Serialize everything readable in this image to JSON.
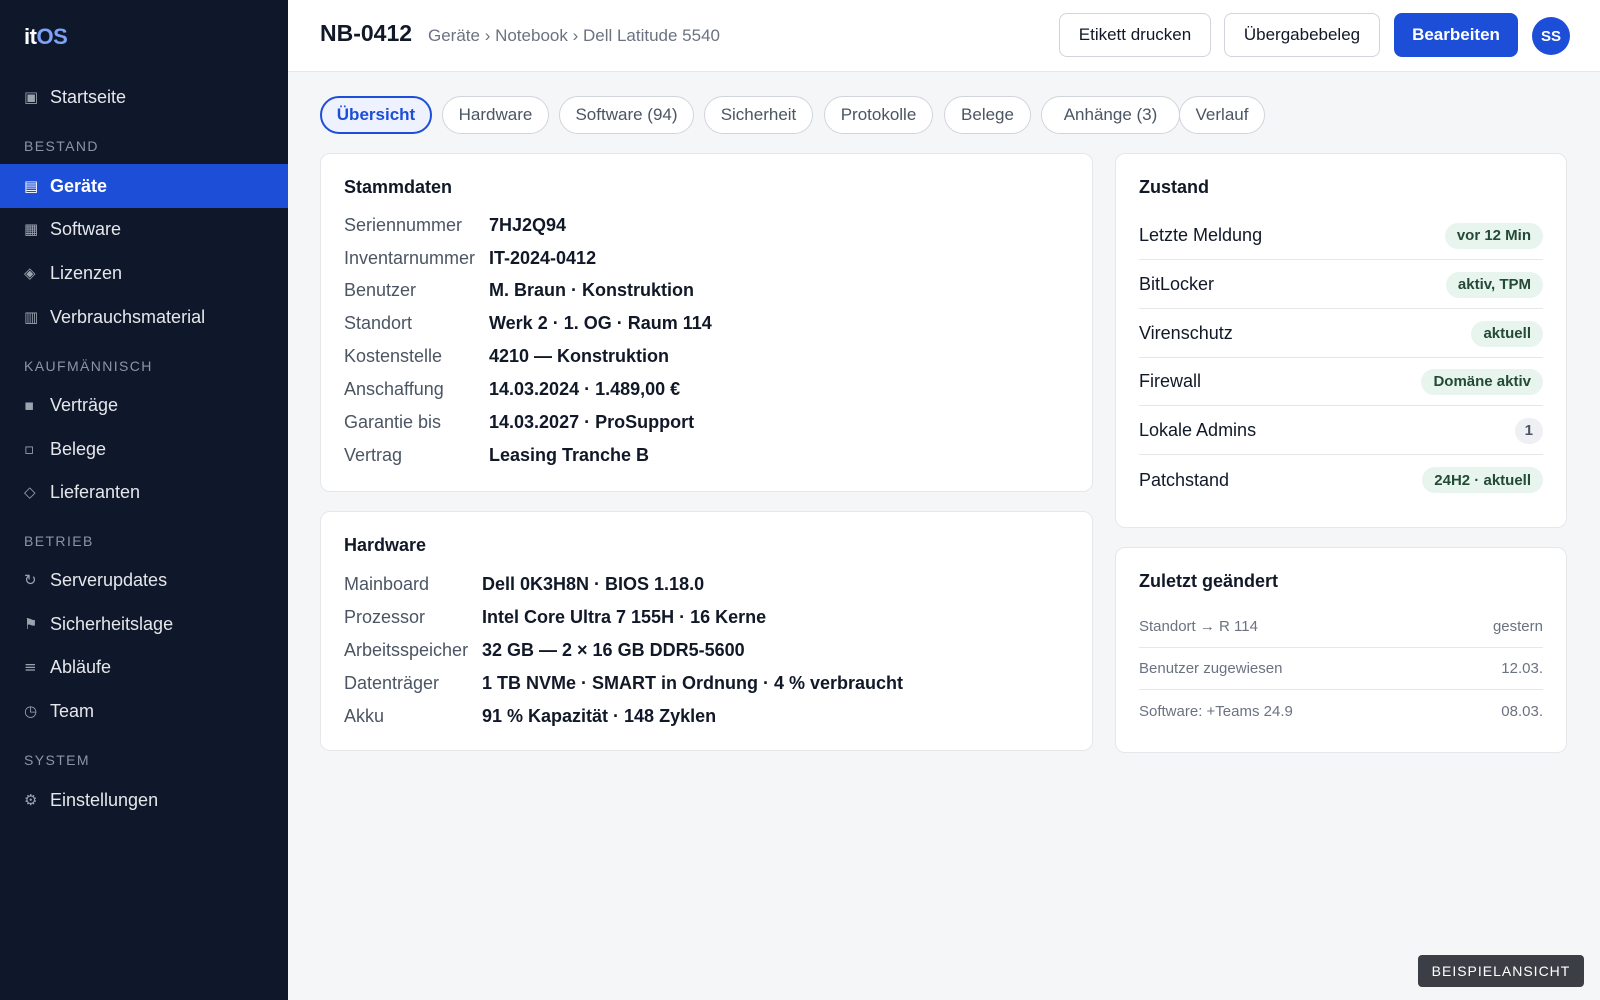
{
  "app": {
    "logo_it": "it",
    "logo_os": "OS"
  },
  "sidebar": {
    "home": {
      "label": "Startseite",
      "icon": "▣"
    },
    "sections": [
      "BESTAND",
      "KAUFMÄNNISCH",
      "BETRIEB",
      "SYSTEM"
    ],
    "items": [
      {
        "label": "Geräte",
        "icon": "▤",
        "active": true
      },
      {
        "label": "Software",
        "icon": "▦"
      },
      {
        "label": "Lizenzen",
        "icon": "◈"
      },
      {
        "label": "Verbrauchsmaterial",
        "icon": "▥"
      },
      {
        "label": "Verträge",
        "icon": "▪"
      },
      {
        "label": "Belege",
        "icon": "▫"
      },
      {
        "label": "Lieferanten",
        "icon": "◇"
      },
      {
        "label": "Serverupdates",
        "icon": "↻"
      },
      {
        "label": "Sicherheitslage",
        "icon": "⚑"
      },
      {
        "label": "Abläufe",
        "icon": "≡"
      },
      {
        "label": "Team",
        "icon": "◷"
      },
      {
        "label": "Einstellungen",
        "icon": "⚙"
      }
    ]
  },
  "header": {
    "title": "NB-0412",
    "breadcrumb": "Geräte › Notebook › Dell Latitude 5540",
    "buttons": {
      "print_label": "Etikett drucken",
      "handover": "Übergabebeleg",
      "edit": "Bearbeiten"
    },
    "avatar": "SS"
  },
  "tabs": [
    "Übersicht",
    "Hardware",
    "Software (94)",
    "Sicherheit",
    "Protokolle",
    "Belege",
    "Anhänge (3)",
    "Verlauf"
  ],
  "stammdaten": {
    "title": "Stammdaten",
    "rows": [
      {
        "label": "Seriennummer",
        "value": "7HJ2Q94"
      },
      {
        "label": "Inventarnummer",
        "value": "IT-2024-0412"
      },
      {
        "label": "Benutzer",
        "value": "M. Braun · Konstruktion"
      },
      {
        "label": "Standort",
        "value": "Werk 2 · 1. OG · Raum 114"
      },
      {
        "label": "Kostenstelle",
        "value": "4210 — Konstruktion"
      },
      {
        "label": "Anschaffung",
        "value": "14.03.2024 · 1.489,00 €"
      },
      {
        "label": "Garantie bis",
        "value": "14.03.2027 · ProSupport"
      },
      {
        "label": "Vertrag",
        "value": "Leasing Tranche B"
      }
    ]
  },
  "hardware": {
    "title": "Hardware",
    "rows": [
      {
        "label": "Mainboard",
        "value": "Dell 0K3H8N · BIOS 1.18.0"
      },
      {
        "label": "Prozessor",
        "value": "Intel Core Ultra 7 155H · 16 Kerne"
      },
      {
        "label": "Arbeitsspeicher",
        "value": "32 GB — 2 × 16 GB DDR5-5600"
      },
      {
        "label": "Datenträger",
        "value": "1 TB NVMe · SMART in Ordnung · 4 % verbraucht"
      },
      {
        "label": "Akku",
        "value": "91 % Kapazität · 148 Zyklen"
      }
    ]
  },
  "zustand": {
    "title": "Zustand",
    "rows": [
      {
        "label": "Letzte Meldung",
        "badge": "vor 12 Min"
      },
      {
        "label": "BitLocker",
        "badge": "aktiv, TPM"
      },
      {
        "label": "Virenschutz",
        "badge": "aktuell"
      },
      {
        "label": "Firewall",
        "badge": "Domäne aktiv"
      },
      {
        "label": "Lokale Admins",
        "badge": "1"
      },
      {
        "label": "Patchstand",
        "badge": "24H2 · aktuell"
      }
    ]
  },
  "changes": {
    "title": "Zuletzt geändert",
    "rows": [
      {
        "label": "Standort → R 114",
        "date": "gestern"
      },
      {
        "label": "Benutzer zugewiesen",
        "date": "12.03."
      },
      {
        "label": "Software: +Teams 24.9",
        "date": "08.03."
      }
    ]
  },
  "footer_tag": "BEISPIELANSICHT",
  "colors": {
    "accent": "#1d4ed8",
    "sidebar_bg": "#0f172a",
    "badge_bg": "#e8f5ee"
  }
}
